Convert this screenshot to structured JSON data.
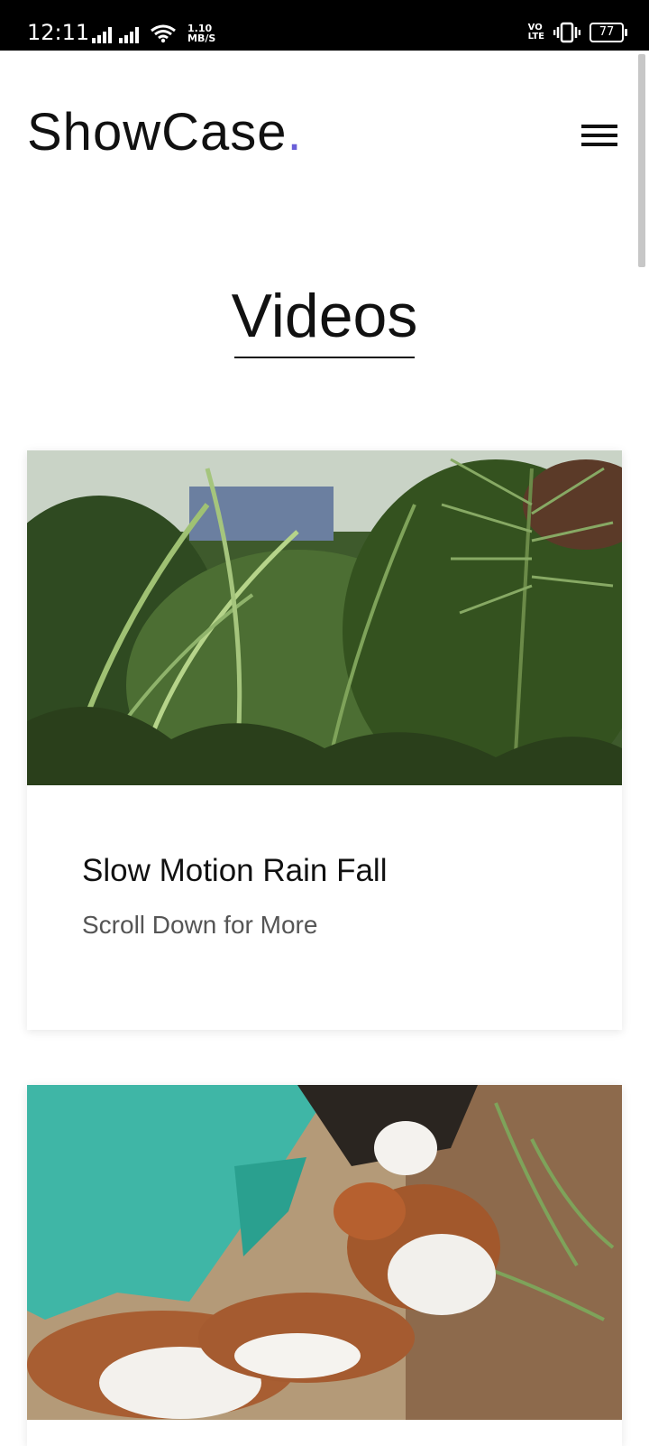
{
  "status_bar": {
    "time": "12:11",
    "speed_value": "1.10",
    "speed_unit": "MB/S",
    "network_label_top": "VO",
    "network_label_bottom": "LTE",
    "battery": "77"
  },
  "header": {
    "logo_text": "ShowCase",
    "logo_dot": ".",
    "menu_icon": "hamburger-menu-icon"
  },
  "section": {
    "title": "Videos"
  },
  "videos": [
    {
      "title": "Slow Motion Rain Fall",
      "subtitle": "Scroll Down for More",
      "thumbnail": "rain-plants-thumbnail"
    },
    {
      "thumbnail": "puppies-thumbnail"
    }
  ],
  "colors": {
    "accent_dot": "#6a5fd8",
    "text": "#111111",
    "subtext": "#555555",
    "status_bar_bg": "#000000"
  }
}
